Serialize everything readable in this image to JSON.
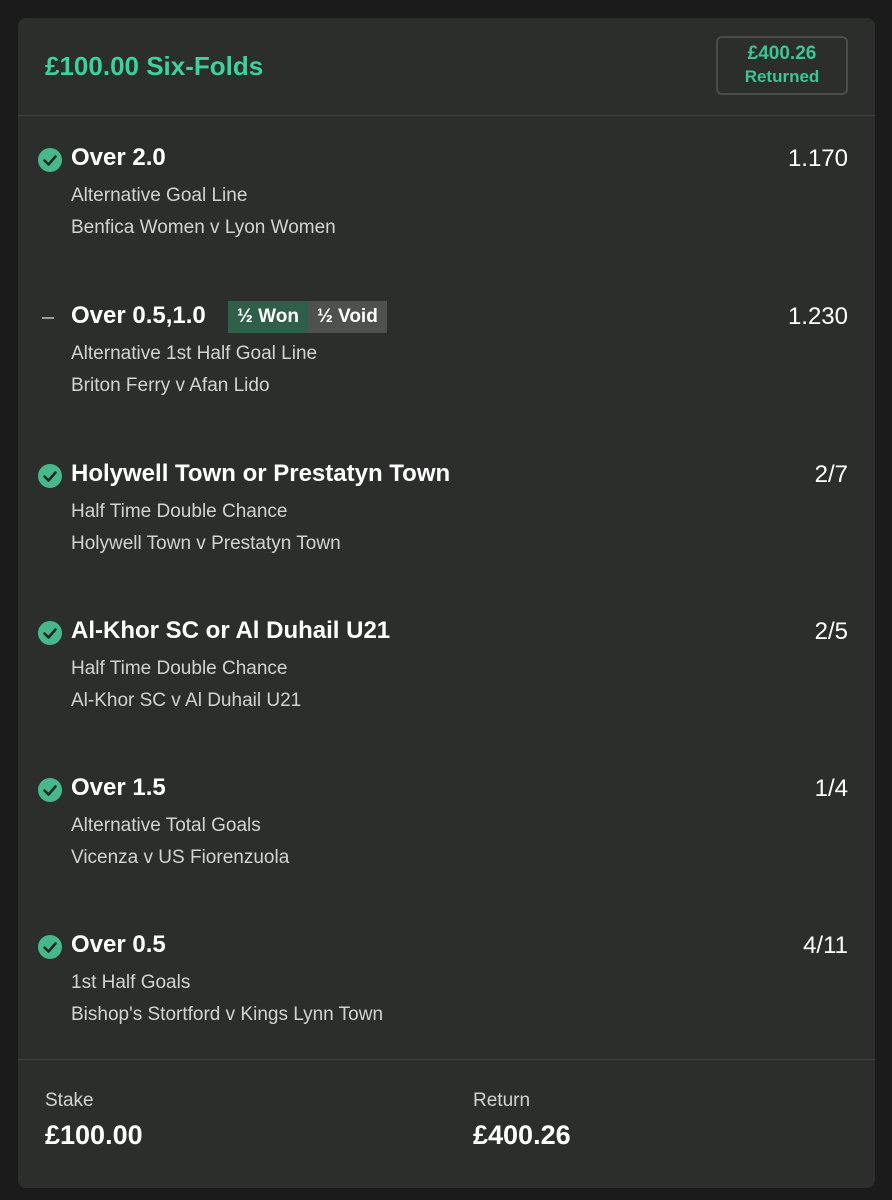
{
  "header": {
    "title": "£100.00 Six-Folds",
    "returned_amount": "£400.26",
    "returned_label": "Returned"
  },
  "selections": [
    {
      "status": "won",
      "name": "Over 2.0",
      "odds": "1.170",
      "market": "Alternative Goal Line",
      "event": "Benfica Women v Lyon Women"
    },
    {
      "status": "half",
      "name": "Over 0.5,1.0",
      "odds": "1.230",
      "market": "Alternative 1st Half Goal Line",
      "event": "Briton Ferry v Afan Lido",
      "tags": [
        "½ Won",
        "½ Void"
      ]
    },
    {
      "status": "won",
      "name": "Holywell Town or Prestatyn Town",
      "odds": "2/7",
      "market": "Half Time Double Chance",
      "event": "Holywell Town v Prestatyn Town"
    },
    {
      "status": "won",
      "name": "Al-Khor SC or Al Duhail U21",
      "odds": "2/5",
      "market": "Half Time Double Chance",
      "event": "Al-Khor SC v Al Duhail U21"
    },
    {
      "status": "won",
      "name": "Over 1.5",
      "odds": "1/4",
      "market": "Alternative Total Goals",
      "event": "Vicenza v US Fiorenzuola"
    },
    {
      "status": "won",
      "name": "Over 0.5",
      "odds": "4/11",
      "market": "1st Half Goals",
      "event": "Bishop's Stortford v Kings Lynn Town"
    }
  ],
  "footer": {
    "stake_label": "Stake",
    "stake_value": "£100.00",
    "return_label": "Return",
    "return_value": "£400.26"
  },
  "colors": {
    "accent": "#3bd39a",
    "check": "#46b88b",
    "won_tag": "#2f5f49",
    "void_tag": "#4e514e"
  }
}
